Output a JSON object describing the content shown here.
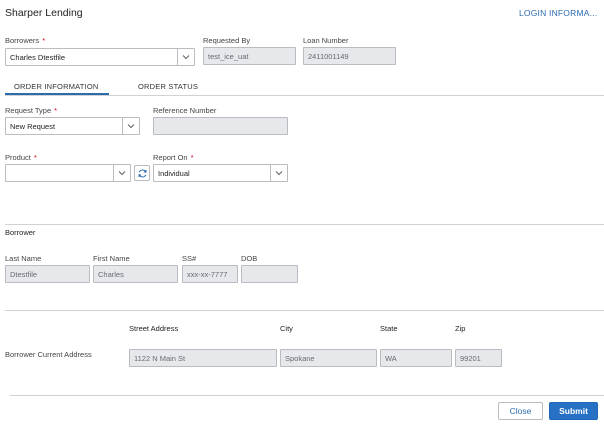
{
  "app": {
    "title": "Sharper Lending",
    "login_link": "LOGIN INFORMA..."
  },
  "header_fields": {
    "borrowers": {
      "label": "Borrowers",
      "value": "Charles Dtestfile",
      "required": true
    },
    "requested_by": {
      "label": "Requested By",
      "value": "test_ice_uat"
    },
    "loan_number": {
      "label": "Loan Number",
      "value": "2411001149"
    }
  },
  "tabs": [
    {
      "label": "ORDER INFORMATION",
      "active": true
    },
    {
      "label": "ORDER STATUS",
      "active": false
    }
  ],
  "order": {
    "request_type": {
      "label": "Request Type",
      "value": "New Request",
      "required": true
    },
    "reference_number": {
      "label": "Reference Number",
      "value": ""
    },
    "product": {
      "label": "Product",
      "value": "",
      "required": true
    },
    "report_on": {
      "label": "Report On",
      "value": "Individual",
      "required": true
    }
  },
  "borrower": {
    "section_title": "Borrower",
    "last_name": {
      "label": "Last Name",
      "value": "Dtestfile"
    },
    "first_name": {
      "label": "First Name",
      "value": "Charles"
    },
    "ssn": {
      "label": "SS#",
      "value": "xxx-xx-7777"
    },
    "dob": {
      "label": "DOB",
      "value": ""
    }
  },
  "address": {
    "row_label": "Borrower Current Address",
    "headers": {
      "street": "Street Address",
      "city": "City",
      "state": "State",
      "zip": "Zip"
    },
    "values": {
      "street": "1122 N Main St",
      "city": "Spokane",
      "state": "WA",
      "zip": "99201"
    }
  },
  "footer": {
    "close_label": "Close",
    "submit_label": "Submit"
  },
  "colors": {
    "accent": "#2b6cb0",
    "required": "#d0021b",
    "readonly_bg": "#e6e8eb",
    "submit_bg": "#2771c4"
  }
}
